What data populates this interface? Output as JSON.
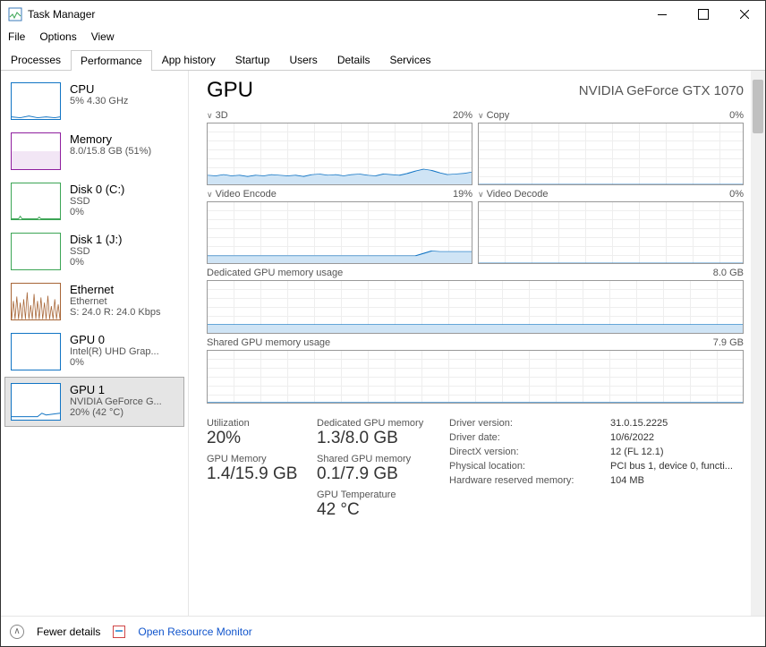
{
  "window": {
    "title": "Task Manager"
  },
  "menu": {
    "file": "File",
    "options": "Options",
    "view": "View"
  },
  "tabs": {
    "processes": "Processes",
    "performance": "Performance",
    "app_history": "App history",
    "startup": "Startup",
    "users": "Users",
    "details": "Details",
    "services": "Services"
  },
  "sidebar": {
    "items": [
      {
        "name": "CPU",
        "sub1": "5%  4.30 GHz"
      },
      {
        "name": "Memory",
        "sub1": "8.0/15.8 GB (51%)"
      },
      {
        "name": "Disk 0 (C:)",
        "sub1": "SSD",
        "sub2": "0%"
      },
      {
        "name": "Disk 1 (J:)",
        "sub1": "SSD",
        "sub2": "0%"
      },
      {
        "name": "Ethernet",
        "sub1": "Ethernet",
        "sub2": "S: 24.0  R: 24.0 Kbps"
      },
      {
        "name": "GPU 0",
        "sub1": "Intel(R) UHD Grap...",
        "sub2": "0%"
      },
      {
        "name": "GPU 1",
        "sub1": "NVIDIA GeForce G...",
        "sub2": "20%  (42 °C)"
      }
    ]
  },
  "page": {
    "title": "GPU",
    "subtitle": "NVIDIA GeForce GTX 1070",
    "graphs": {
      "r1": [
        {
          "label": "3D",
          "pct": "20%"
        },
        {
          "label": "Copy",
          "pct": "0%"
        }
      ],
      "r2": [
        {
          "label": "Video Encode",
          "pct": "19%"
        },
        {
          "label": "Video Decode",
          "pct": "0%"
        }
      ],
      "mem1": {
        "label": "Dedicated GPU memory usage",
        "max": "8.0 GB"
      },
      "mem2": {
        "label": "Shared GPU memory usage",
        "max": "7.9 GB"
      }
    },
    "stats": {
      "c1": [
        {
          "lbl": "Utilization",
          "val": "20%"
        },
        {
          "lbl": "GPU Memory",
          "val": "1.4/15.9 GB"
        }
      ],
      "c2": [
        {
          "lbl": "Dedicated GPU memory",
          "val": "1.3/8.0 GB"
        },
        {
          "lbl": "Shared GPU memory",
          "val": "0.1/7.9 GB"
        },
        {
          "lbl": "GPU Temperature",
          "val": "42 °C"
        }
      ],
      "meta": [
        {
          "k": "Driver version:",
          "v": "31.0.15.2225"
        },
        {
          "k": "Driver date:",
          "v": "10/6/2022"
        },
        {
          "k": "DirectX version:",
          "v": "12 (FL 12.1)"
        },
        {
          "k": "Physical location:",
          "v": "PCI bus 1, device 0, functi..."
        },
        {
          "k": "Hardware reserved memory:",
          "v": "104 MB"
        }
      ]
    }
  },
  "footer": {
    "fewer": "Fewer details",
    "resmon": "Open Resource Monitor"
  },
  "chart_data": [
    {
      "type": "area",
      "title": "3D",
      "ylim": [
        0,
        100
      ],
      "values": [
        15,
        14,
        16,
        14,
        15,
        13,
        15,
        14,
        16,
        15,
        14,
        15,
        13,
        16,
        17,
        15,
        16,
        14,
        16,
        17,
        15,
        14,
        17,
        16,
        15,
        18,
        22,
        25,
        23,
        19,
        16,
        17,
        18,
        20
      ]
    },
    {
      "type": "area",
      "title": "Copy",
      "ylim": [
        0,
        100
      ],
      "values": [
        0,
        0,
        0,
        0,
        0,
        0,
        0,
        0,
        0,
        0,
        0,
        0,
        0,
        0,
        0,
        0,
        0,
        0,
        0,
        0,
        0,
        0,
        0,
        0,
        0,
        0,
        0,
        0,
        0,
        0,
        0,
        0,
        0,
        0
      ]
    },
    {
      "type": "area",
      "title": "Video Encode",
      "ylim": [
        0,
        100
      ],
      "values": [
        12,
        12,
        12,
        12,
        12,
        12,
        12,
        12,
        12,
        12,
        12,
        12,
        12,
        12,
        12,
        12,
        12,
        12,
        12,
        12,
        12,
        12,
        12,
        12,
        12,
        12,
        12,
        16,
        20,
        19,
        19,
        19,
        19,
        19
      ]
    },
    {
      "type": "area",
      "title": "Video Decode",
      "ylim": [
        0,
        100
      ],
      "values": [
        0,
        0,
        0,
        0,
        0,
        0,
        0,
        0,
        0,
        0,
        0,
        0,
        0,
        0,
        0,
        0,
        0,
        0,
        0,
        0,
        0,
        0,
        0,
        0,
        0,
        0,
        0,
        0,
        0,
        0,
        0,
        0,
        0,
        0
      ]
    },
    {
      "type": "area",
      "title": "Dedicated GPU memory usage",
      "ylim": [
        0,
        8
      ],
      "ylabel": "GB",
      "values": [
        1.3,
        1.3,
        1.3,
        1.3,
        1.3,
        1.3,
        1.3,
        1.3,
        1.3,
        1.3,
        1.3,
        1.3,
        1.3,
        1.3,
        1.3,
        1.3,
        1.3,
        1.3,
        1.3,
        1.3,
        1.3,
        1.3,
        1.3,
        1.3,
        1.3,
        1.3,
        1.3,
        1.3,
        1.3,
        1.3,
        1.3,
        1.3,
        1.3,
        1.3
      ]
    },
    {
      "type": "area",
      "title": "Shared GPU memory usage",
      "ylim": [
        0,
        7.9
      ],
      "ylabel": "GB",
      "values": [
        0.1,
        0.1,
        0.1,
        0.1,
        0.1,
        0.1,
        0.1,
        0.1,
        0.1,
        0.1,
        0.1,
        0.1,
        0.1,
        0.1,
        0.1,
        0.1,
        0.1,
        0.1,
        0.1,
        0.1,
        0.1,
        0.1,
        0.1,
        0.1,
        0.1,
        0.1,
        0.1,
        0.1,
        0.1,
        0.1,
        0.1,
        0.1,
        0.1,
        0.1
      ]
    }
  ]
}
